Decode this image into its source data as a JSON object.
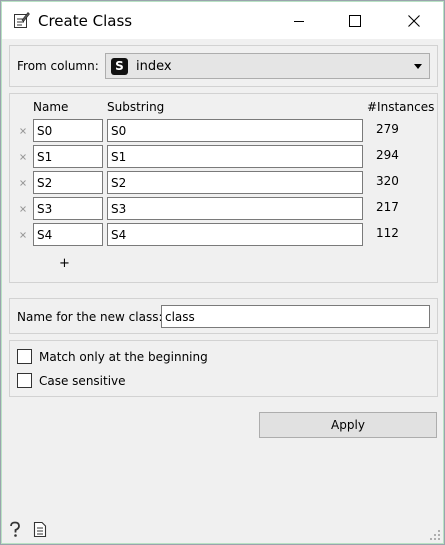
{
  "window": {
    "title": "Create Class",
    "controls": {
      "minimize": "minimize-icon",
      "maximize": "maximize-icon",
      "close": "close-icon"
    }
  },
  "source": {
    "label": "From column:",
    "selected_type_badge": "S",
    "selected_value": "index"
  },
  "rules": {
    "headers": {
      "name": "Name",
      "substring": "Substring",
      "instances": "#Instances"
    },
    "rows": [
      {
        "name": "S0",
        "substring": "S0",
        "instances": "279"
      },
      {
        "name": "S1",
        "substring": "S1",
        "instances": "294"
      },
      {
        "name": "S2",
        "substring": "S2",
        "instances": "320"
      },
      {
        "name": "S3",
        "substring": "S3",
        "instances": "217"
      },
      {
        "name": "S4",
        "substring": "S4",
        "instances": "112"
      }
    ],
    "add_label": "+"
  },
  "new_class": {
    "label": "Name for the new class:",
    "value": "class"
  },
  "options": {
    "match_beginning": {
      "label": "Match only at the beginning",
      "checked": false
    },
    "case_sensitive": {
      "label": "Case sensitive",
      "checked": false
    }
  },
  "actions": {
    "apply_label": "Apply"
  },
  "footer": {
    "help_icon": "help-icon",
    "report_icon": "report-icon"
  },
  "colors": {
    "window_bg": "#f0f0f0",
    "titlebar_bg": "#ffffff",
    "button_bg": "#e1e1e1"
  }
}
